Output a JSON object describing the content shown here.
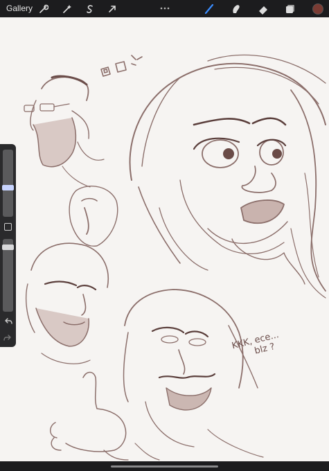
{
  "topbar": {
    "gallery_label": "Gallery",
    "tools_left": [
      "wrench-icon",
      "magic-wand-icon",
      "selection-s-icon",
      "transform-arrow-icon"
    ],
    "tools_right": [
      "brush-icon",
      "smudge-icon",
      "eraser-icon",
      "layers-icon",
      "color-swatch"
    ],
    "active_tool": "brush",
    "active_color": "#7a3b33"
  },
  "sidebar": {
    "brush_size_level": 0.5,
    "opacity_level": 0.0,
    "icons": [
      "modify-square-icon",
      "undo-icon",
      "redo-icon"
    ]
  },
  "canvas": {
    "sketch_color": "#8b6e6a",
    "speech_text_line1": "KKK, ece...",
    "speech_text_line2": "blz ?"
  }
}
